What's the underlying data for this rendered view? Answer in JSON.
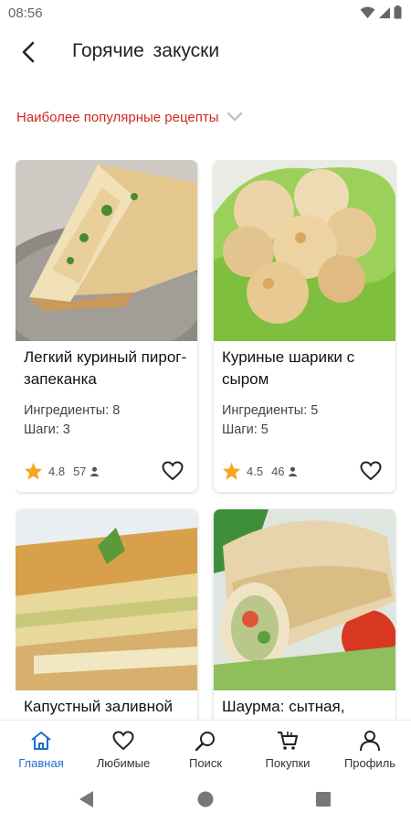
{
  "status_bar": {
    "time": "08:56"
  },
  "header": {
    "title": "Горячие  закуски"
  },
  "sort": {
    "label": "Наиболее популярные рецепты"
  },
  "cards": [
    {
      "title": "Легкий куриный пирог-запеканка",
      "ingredients": "Ингредиенты: 8",
      "steps": "Шаги: 3",
      "rating": "4.8",
      "votes": "57"
    },
    {
      "title": "Куриные шарики с сыром",
      "ingredients": "Ингредиенты: 5",
      "steps": "Шаги: 5",
      "rating": "4.5",
      "votes": "46"
    },
    {
      "title": "Капустный заливной",
      "ingredients": "",
      "steps": "",
      "rating": "",
      "votes": ""
    },
    {
      "title": "Шаурма: сытная,",
      "ingredients": "",
      "steps": "",
      "rating": "",
      "votes": ""
    }
  ],
  "bottom_nav": [
    {
      "label": "Главная",
      "icon": "home-icon",
      "active": true
    },
    {
      "label": "Любимые",
      "icon": "heart-icon",
      "active": false
    },
    {
      "label": "Поиск",
      "icon": "search-icon",
      "active": false
    },
    {
      "label": "Покупки",
      "icon": "cart-icon",
      "active": false
    },
    {
      "label": "Профиль",
      "icon": "profile-icon",
      "active": false
    }
  ],
  "colors": {
    "accent": "#1e6fc8",
    "sort_text": "#d12a1f",
    "star": "#f5a623"
  }
}
